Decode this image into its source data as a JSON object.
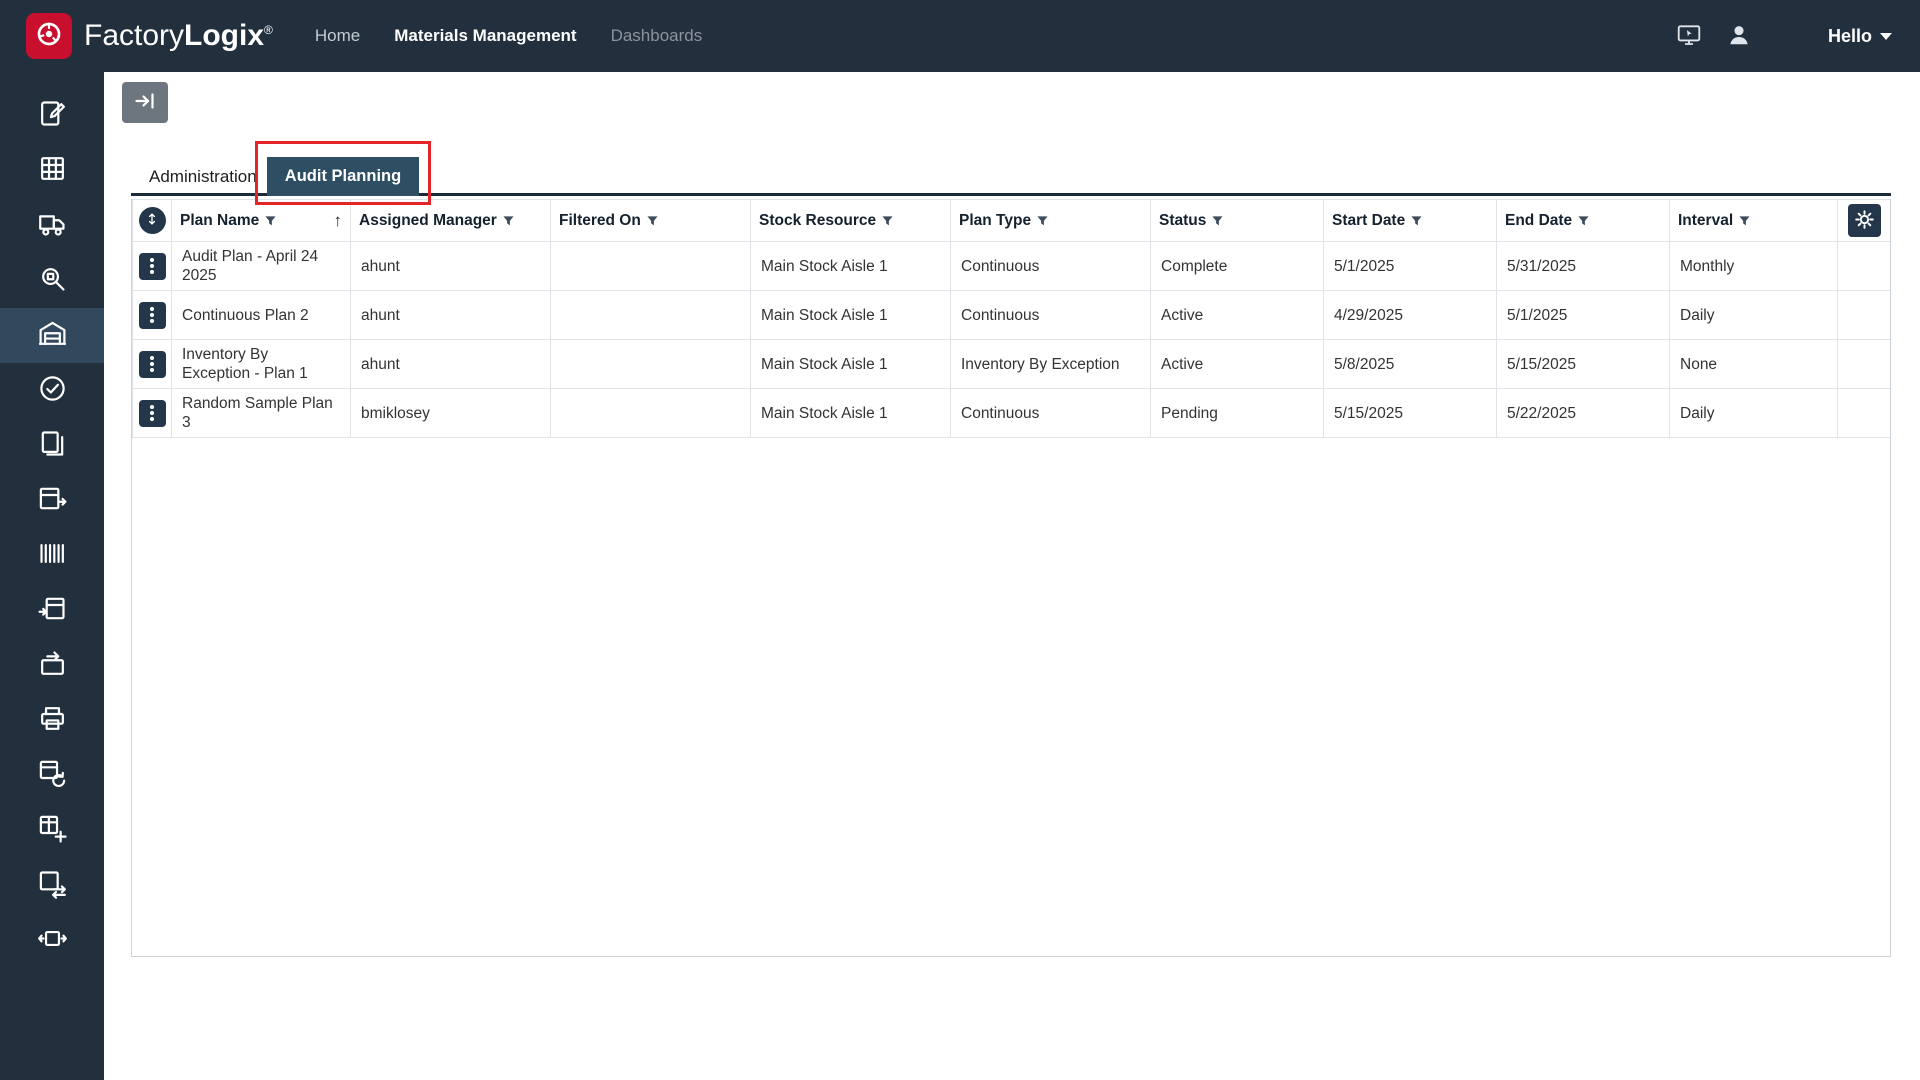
{
  "brand": {
    "factory": "Factory",
    "logix": "Logix",
    "registered": "®"
  },
  "nav": {
    "home": "Home",
    "materials": "Materials Management",
    "dashboards": "Dashboards"
  },
  "header_right": {
    "greeting": "Hello"
  },
  "sidebar": {
    "items": [
      {
        "icon": "clipboard-pencil-icon"
      },
      {
        "icon": "grid-icon"
      },
      {
        "icon": "truck-icon"
      },
      {
        "icon": "scan-search-icon"
      },
      {
        "icon": "warehouse-icon",
        "active": true
      },
      {
        "icon": "circle-check-icon"
      },
      {
        "icon": "documents-icon"
      },
      {
        "icon": "table-export-icon"
      },
      {
        "icon": "barcode-icon"
      },
      {
        "icon": "table-import-icon"
      },
      {
        "icon": "return-arrow-icon"
      },
      {
        "icon": "printer-icon"
      },
      {
        "icon": "table-refresh-icon"
      },
      {
        "icon": "table-add-icon"
      },
      {
        "icon": "table-sync-icon"
      },
      {
        "icon": "transfer-arrows-icon"
      }
    ]
  },
  "tabs": {
    "administration": "Administration",
    "audit_planning": "Audit Planning"
  },
  "table": {
    "sort_indicator": "↑",
    "headers": {
      "plan_name": "Plan Name",
      "assigned_manager": "Assigned Manager",
      "filtered_on": "Filtered On",
      "stock_resource": "Stock Resource",
      "plan_type": "Plan Type",
      "status": "Status",
      "start_date": "Start Date",
      "end_date": "End Date",
      "interval": "Interval"
    },
    "rows": [
      {
        "plan_name": "Audit Plan - April 24 2025",
        "assigned_manager": "ahunt",
        "filtered_on": "",
        "stock_resource": "Main Stock Aisle 1",
        "plan_type": "Continuous",
        "status": "Complete",
        "start_date": "5/1/2025",
        "end_date": "5/31/2025",
        "interval": "Monthly"
      },
      {
        "plan_name": "Continuous Plan 2",
        "assigned_manager": "ahunt",
        "filtered_on": "",
        "stock_resource": "Main Stock Aisle 1",
        "plan_type": "Continuous",
        "status": "Active",
        "start_date": "4/29/2025",
        "end_date": "5/1/2025",
        "interval": "Daily"
      },
      {
        "plan_name": "Inventory By Exception - Plan 1",
        "assigned_manager": "ahunt",
        "filtered_on": "",
        "stock_resource": "Main Stock Aisle 1",
        "plan_type": "Inventory By Exception",
        "status": "Active",
        "start_date": "5/8/2025",
        "end_date": "5/15/2025",
        "interval": "None"
      },
      {
        "plan_name": "Random Sample Plan 3",
        "assigned_manager": "bmiklosey",
        "filtered_on": "",
        "stock_resource": "Main Stock Aisle 1",
        "plan_type": "Continuous",
        "status": "Pending",
        "start_date": "5/15/2025",
        "end_date": "5/22/2025",
        "interval": "Daily"
      }
    ]
  },
  "colors": {
    "navy": "#222f3d",
    "brand_red": "#c8102e",
    "tab_active_bg": "#2d4e63",
    "annotation_red": "#e42527",
    "sidebar_active_bg": "#32485c"
  }
}
